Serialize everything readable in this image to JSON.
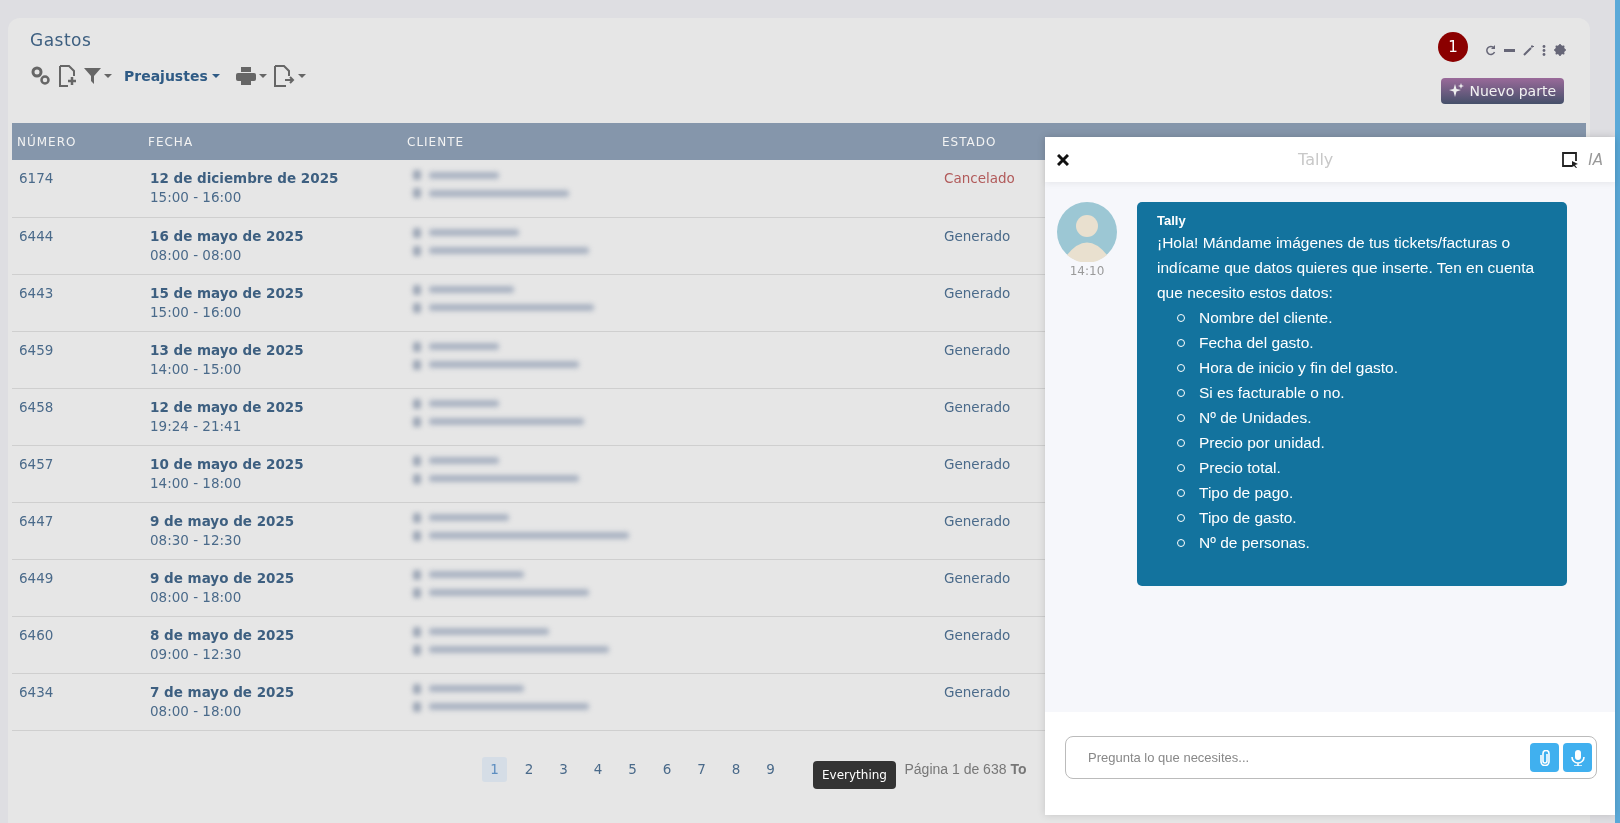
{
  "page": {
    "title": "Gastos"
  },
  "toolbar": {
    "presets_label": "Preajustes"
  },
  "notification_badge": "1",
  "new_button": {
    "label": "Nuevo parte"
  },
  "table": {
    "columns": [
      "NÚMERO",
      "FECHA",
      "CLIENTE",
      "ESTADO"
    ],
    "rows": [
      {
        "number": "6174",
        "date": "12 de diciembre de 2025",
        "time": "15:00 - 16:00",
        "status": "Cancelado",
        "kind": "cancelled"
      },
      {
        "number": "6444",
        "date": "16 de mayo de 2025",
        "time": "08:00 - 08:00",
        "status": "Generado",
        "kind": "generated"
      },
      {
        "number": "6443",
        "date": "15 de mayo de 2025",
        "time": "15:00 - 16:00",
        "status": "Generado",
        "kind": "generated"
      },
      {
        "number": "6459",
        "date": "13 de mayo de 2025",
        "time": "14:00 - 15:00",
        "status": "Generado",
        "kind": "generated"
      },
      {
        "number": "6458",
        "date": "12 de mayo de 2025",
        "time": "19:24 - 21:41",
        "status": "Generado",
        "kind": "generated"
      },
      {
        "number": "6457",
        "date": "10 de mayo de 2025",
        "time": "14:00 - 18:00",
        "status": "Generado",
        "kind": "generated"
      },
      {
        "number": "6447",
        "date": "9 de mayo de 2025",
        "time": "08:30 - 12:30",
        "status": "Generado",
        "kind": "generated"
      },
      {
        "number": "6449",
        "date": "9 de mayo de 2025",
        "time": "08:00 - 18:00",
        "status": "Generado",
        "kind": "generated"
      },
      {
        "number": "6460",
        "date": "8 de mayo de 2025",
        "time": "09:00 - 12:30",
        "status": "Generado",
        "kind": "generated"
      },
      {
        "number": "6434",
        "date": "7 de mayo de 2025",
        "time": "08:00 - 18:00",
        "status": "Generado",
        "kind": "generated"
      }
    ]
  },
  "pagination": {
    "pages": [
      {
        "label": "1",
        "selected": true
      },
      {
        "label": "2",
        "selected": false
      },
      {
        "label": "3",
        "selected": false
      },
      {
        "label": "4",
        "selected": false
      },
      {
        "label": "5",
        "selected": false
      },
      {
        "label": "6",
        "selected": false
      },
      {
        "label": "7",
        "selected": false
      },
      {
        "label": "8",
        "selected": false
      },
      {
        "label": "9",
        "selected": false
      }
    ],
    "summary": "Página 1 de 638 **To**"
  },
  "tooltip": "Everything",
  "chat": {
    "title": "Tally",
    "mode_label": "IA",
    "messages": [
      {
        "sender": "Tally",
        "time": "14:10",
        "text": "¡Hola! Mándame imágenes de tus tickets/facturas o indícame que datos quieres que inserte. Ten en cuenta que necesito estos datos:",
        "items": [
          "Nombre del cliente.",
          "Fecha del gasto.",
          "Hora de inicio y fin del gasto.",
          "Si es facturable o no.",
          "Nº de Unidades.",
          "Precio por unidad.",
          "Precio total.",
          "Tipo de pago.",
          "Tipo de gasto.",
          "Nº de personas."
        ]
      }
    ],
    "input": {
      "placeholder": "Pregunta lo que necesites..."
    }
  }
}
